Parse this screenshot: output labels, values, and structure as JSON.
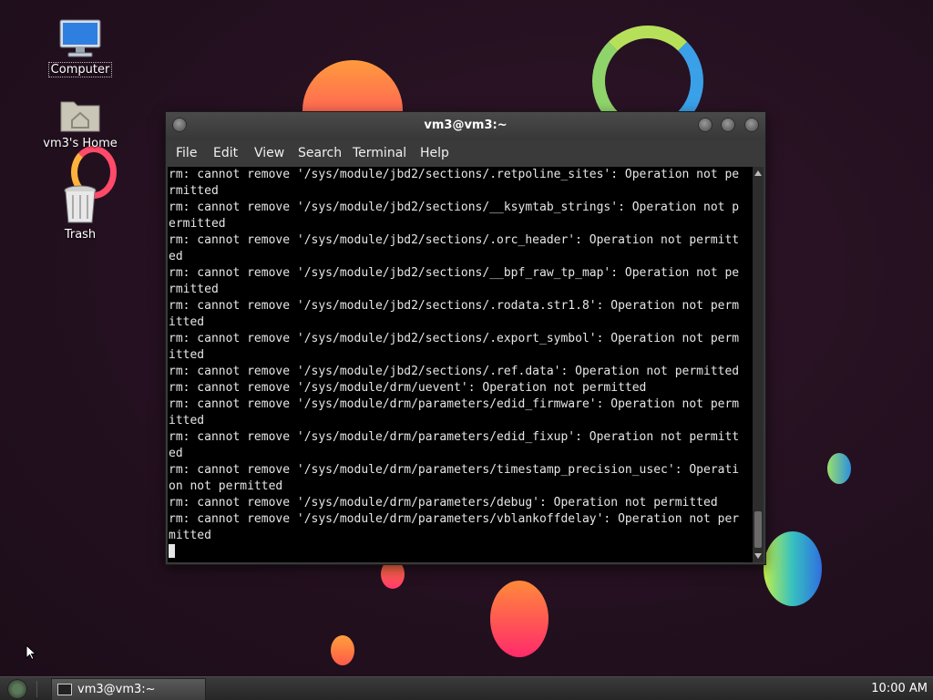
{
  "desktop": {
    "icons": [
      {
        "label": "Computer",
        "icon": "computer-icon"
      },
      {
        "label": "vm3's Home",
        "icon": "home-folder-icon"
      },
      {
        "label": "Trash",
        "icon": "trash-icon"
      }
    ]
  },
  "window": {
    "title": "vm3@vm3:~",
    "menu": [
      "File",
      "Edit",
      "View",
      "Search",
      "Terminal",
      "Help"
    ]
  },
  "terminal": {
    "lines": [
      "rm: cannot remove '/sys/module/jbd2/sections/.retpoline_sites': Operation not pe",
      "rmitted",
      "rm: cannot remove '/sys/module/jbd2/sections/__ksymtab_strings': Operation not p",
      "ermitted",
      "rm: cannot remove '/sys/module/jbd2/sections/.orc_header': Operation not permitt",
      "ed",
      "rm: cannot remove '/sys/module/jbd2/sections/__bpf_raw_tp_map': Operation not pe",
      "rmitted",
      "rm: cannot remove '/sys/module/jbd2/sections/.rodata.str1.8': Operation not perm",
      "itted",
      "rm: cannot remove '/sys/module/jbd2/sections/.export_symbol': Operation not perm",
      "itted",
      "rm: cannot remove '/sys/module/jbd2/sections/.ref.data': Operation not permitted",
      "rm: cannot remove '/sys/module/drm/uevent': Operation not permitted",
      "rm: cannot remove '/sys/module/drm/parameters/edid_firmware': Operation not perm",
      "itted",
      "rm: cannot remove '/sys/module/drm/parameters/edid_fixup': Operation not permitt",
      "ed",
      "rm: cannot remove '/sys/module/drm/parameters/timestamp_precision_usec': Operati",
      "on not permitted",
      "rm: cannot remove '/sys/module/drm/parameters/debug': Operation not permitted",
      "rm: cannot remove '/sys/module/drm/parameters/vblankoffdelay': Operation not per",
      "mitted"
    ]
  },
  "taskbar": {
    "task_label": "vm3@vm3:~",
    "clock": "10:00 AM"
  },
  "colors": {
    "terminal_bg": "#000000",
    "terminal_fg": "#e6e6e6",
    "wallpaper": "#24121f"
  }
}
